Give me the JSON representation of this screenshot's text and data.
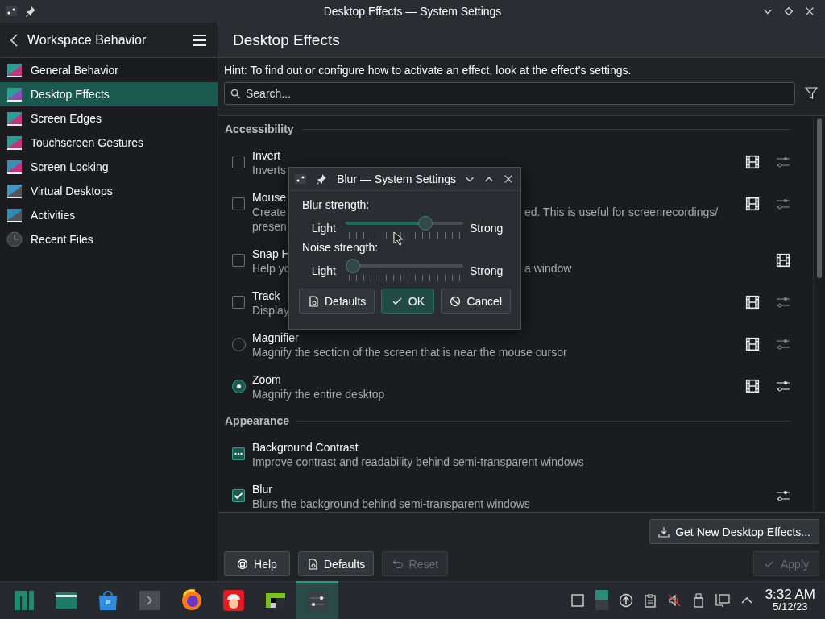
{
  "window": {
    "title": "Desktop Effects — System Settings"
  },
  "sidebar": {
    "title": "Workspace Behavior",
    "items": [
      {
        "label": "General Behavior",
        "selected": false
      },
      {
        "label": "Desktop Effects",
        "selected": true
      },
      {
        "label": "Screen Edges",
        "selected": false
      },
      {
        "label": "Touchscreen Gestures",
        "selected": false
      },
      {
        "label": "Screen Locking",
        "selected": false
      },
      {
        "label": "Virtual Desktops",
        "selected": false
      },
      {
        "label": "Activities",
        "selected": false
      },
      {
        "label": "Recent Files",
        "selected": false
      }
    ]
  },
  "page": {
    "title": "Desktop Effects",
    "hint": "Hint: To find out or configure how to activate an effect, look at the effect's settings.",
    "search": {
      "placeholder": "Search..."
    }
  },
  "sections": [
    {
      "title": "Accessibility",
      "effects": [
        {
          "kind": "checkbox",
          "checked": false,
          "title": "Invert",
          "lines": [
            {
              "text": "Inverts"
            }
          ],
          "video": true,
          "configure": true
        },
        {
          "kind": "checkbox",
          "checked": false,
          "title": "Mouse",
          "lines": [
            {
              "text": "Create",
              "tail": "ed. This is useful for screenrecordings/"
            },
            {
              "text": "presen"
            }
          ],
          "video": true,
          "configure": true
        },
        {
          "kind": "checkbox",
          "checked": false,
          "title": "Snap H",
          "lines": [
            {
              "text": "Help yo",
              "tail": "a window"
            }
          ],
          "video": true,
          "configure": false
        },
        {
          "kind": "checkbox",
          "checked": false,
          "title": "Track",
          "lines": [
            {
              "text": "Display"
            }
          ],
          "video": true,
          "configure": true
        },
        {
          "kind": "radio",
          "checked": false,
          "title": "Magnifier",
          "lines": [
            {
              "text": "Magnify the section of the screen that is near the mouse cursor"
            }
          ],
          "video": true,
          "configure": true
        },
        {
          "kind": "radio",
          "checked": true,
          "title": "Zoom",
          "lines": [
            {
              "text": "Magnify the entire desktop"
            }
          ],
          "video": true,
          "configure": true
        }
      ]
    },
    {
      "title": "Appearance",
      "effects": [
        {
          "kind": "tristate",
          "checked": true,
          "title": "Background Contrast",
          "lines": [
            {
              "text": "Improve contrast and readability behind semi-transparent windows"
            }
          ],
          "video": false,
          "configure": false
        },
        {
          "kind": "checkbox",
          "checked": true,
          "title": "Blur",
          "lines": [
            {
              "text": "Blurs the background behind semi-transparent windows"
            }
          ],
          "video": false,
          "configure": true
        }
      ]
    }
  ],
  "get_new_button": "Get New Desktop Effects...",
  "footer_buttons": [
    {
      "kind": "help",
      "label": "Help",
      "disabled": false
    },
    {
      "kind": "defaults",
      "label": "Defaults",
      "disabled": false
    },
    {
      "kind": "reset",
      "label": "Reset",
      "disabled": true
    }
  ],
  "apply_button": {
    "label": "Apply",
    "disabled": true
  },
  "dialog": {
    "title": "Blur — System Settings",
    "sliders": [
      {
        "label": "Blur strength:",
        "min_label": "Light",
        "max_label": "Strong",
        "level": 0.7
      },
      {
        "label": "Noise strength:",
        "min_label": "Light",
        "max_label": "Strong",
        "level": 0
      }
    ],
    "buttons": [
      {
        "kind": "defaults",
        "label": "Defaults",
        "default": false
      },
      {
        "kind": "ok",
        "label": "OK",
        "default": true
      },
      {
        "kind": "cancel",
        "label": "Cancel",
        "default": false
      }
    ]
  },
  "taskbar": {
    "apps": [
      {
        "kind": "menu",
        "selected": false
      },
      {
        "kind": "files",
        "selected": false
      },
      {
        "kind": "store",
        "selected": false
      },
      {
        "kind": "terminal",
        "selected": false
      },
      {
        "kind": "browser",
        "selected": false
      },
      {
        "kind": "game",
        "selected": false
      },
      {
        "kind": "launcher",
        "selected": false
      },
      {
        "kind": "settings",
        "selected": true
      }
    ],
    "tray": [
      {
        "kind": "screen"
      },
      {
        "kind": "device"
      },
      {
        "kind": "update"
      },
      {
        "kind": "clipboard"
      },
      {
        "kind": "mute"
      },
      {
        "kind": "usb"
      },
      {
        "kind": "network"
      },
      {
        "kind": "expand"
      }
    ],
    "time": "3:32 AM",
    "date": "5/12/23"
  }
}
